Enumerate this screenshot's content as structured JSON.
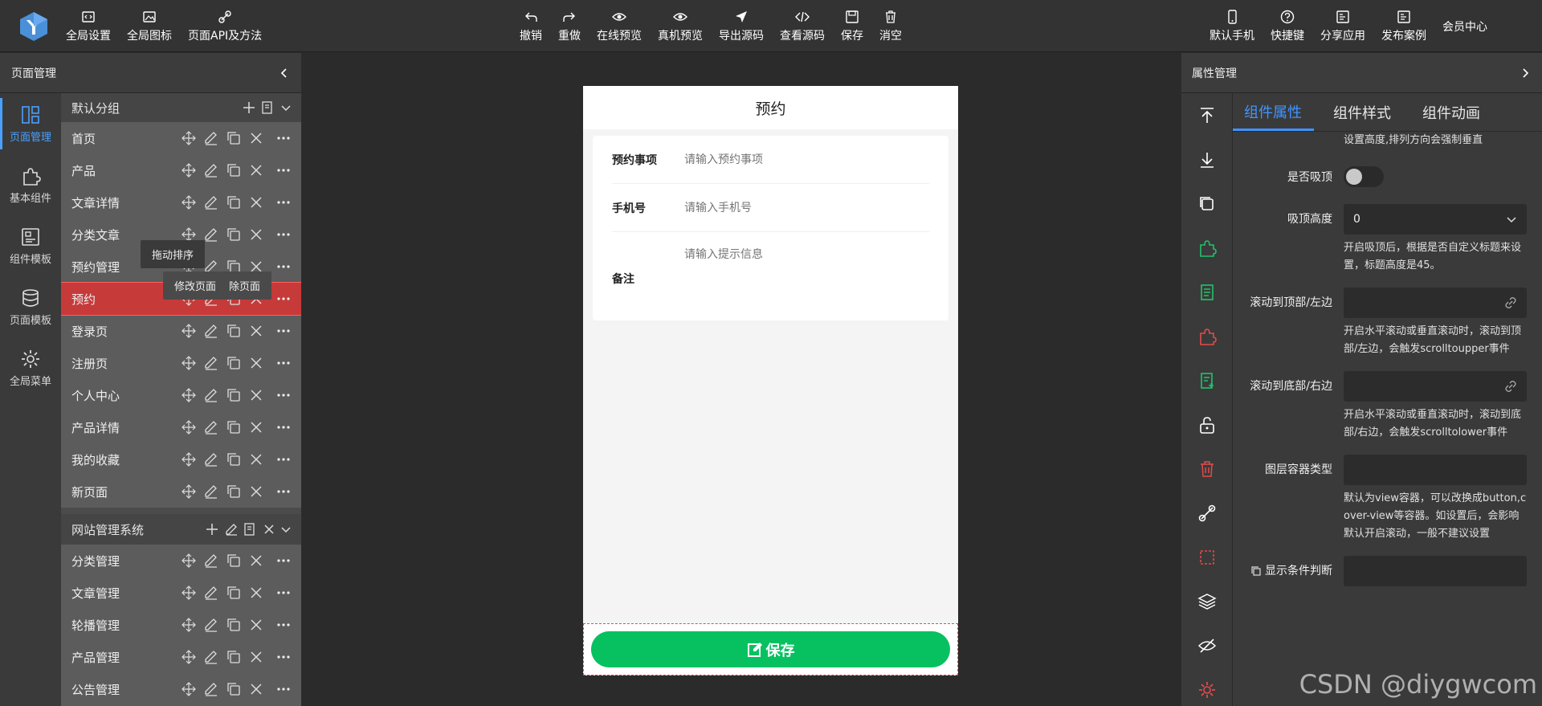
{
  "toolbar": {
    "left": [
      {
        "label": "全局设置",
        "icon": "code-window-icon"
      },
      {
        "label": "全局图标",
        "icon": "image-icon"
      },
      {
        "label": "页面API及方法",
        "icon": "api-link-icon"
      }
    ],
    "center": [
      {
        "label": "撤销",
        "icon": "undo-icon"
      },
      {
        "label": "重做",
        "icon": "redo-icon"
      },
      {
        "label": "在线预览",
        "icon": "eye-icon"
      },
      {
        "label": "真机预览",
        "icon": "eye-icon"
      },
      {
        "label": "导出源码",
        "icon": "send-icon"
      },
      {
        "label": "查看源码",
        "icon": "code-icon"
      },
      {
        "label": "保存",
        "icon": "save-icon"
      },
      {
        "label": "消空",
        "icon": "trash-icon"
      }
    ],
    "right": [
      {
        "label": "默认手机",
        "icon": "phone-icon"
      },
      {
        "label": "快捷键",
        "icon": "help-icon"
      },
      {
        "label": "分享应用",
        "icon": "share-icon"
      },
      {
        "label": "发布案例",
        "icon": "publish-icon"
      }
    ],
    "member": "会员中心"
  },
  "left_panel": {
    "title": "页面管理",
    "rail": [
      {
        "label": "页面管理",
        "icon": "layout-icon"
      },
      {
        "label": "基本组件",
        "icon": "puzzle-icon"
      },
      {
        "label": "组件模板",
        "icon": "template-icon"
      },
      {
        "label": "页面模板",
        "icon": "database-icon"
      },
      {
        "label": "全局菜单",
        "icon": "gear-icon"
      }
    ],
    "groups": [
      {
        "name": "默认分组",
        "pages": [
          "首页",
          "产品",
          "文章详情",
          "分类文章",
          "预约管理",
          "预约",
          "登录页",
          "注册页",
          "个人中心",
          "产品详情",
          "我的收藏",
          "新页面"
        ]
      },
      {
        "name": "网站管理系统",
        "pages": [
          "分类管理",
          "文章管理",
          "轮播管理",
          "产品管理",
          "公告管理"
        ]
      }
    ],
    "active_page": "预约",
    "tooltip_drag": "拖动排序",
    "tooltip_edit": "修改页面",
    "tooltip_delete": "除页面"
  },
  "phone": {
    "title": "预约",
    "fields": [
      {
        "label": "预约事项",
        "placeholder": "请输入预约事项"
      },
      {
        "label": "手机号",
        "placeholder": "请输入手机号"
      },
      {
        "label": "备注",
        "placeholder": "请输入提示信息"
      }
    ],
    "save_label": "保存"
  },
  "right_panel": {
    "title": "属性管理",
    "tabs": [
      "组件属性",
      "组件样式",
      "组件动画"
    ],
    "active_tab": "组件属性",
    "top_hint": "设置高度,排列方向会强制垂直",
    "props": {
      "sticky_label": "是否吸顶",
      "sticky_height_label": "吸顶高度",
      "sticky_height_value": "0",
      "sticky_height_hint": "开启吸顶后，根据是否自定义标题来设置，标题高度是45。",
      "scroll_top_label": "滚动到顶部/左边",
      "scroll_top_hint": "开启水平滚动或垂直滚动时，滚动到顶部/左边，会触发scrolltoupper事件",
      "scroll_bottom_label": "滚动到底部/右边",
      "scroll_bottom_hint": "开启水平滚动或垂直滚动时，滚动到底部/右边，会触发scrolltolower事件",
      "layer_label": "图层容器类型",
      "layer_hint": "默认为view容器，可以改换成button,cover-view等容器。如设置后，会影响默认开启滚动，一般不建议设置",
      "condition_label": "显示条件判断"
    }
  },
  "watermark": "CSDN @diygwcom",
  "colors": {
    "accent": "#3f95ff",
    "danger": "#c63a3a",
    "save": "#07c160"
  }
}
